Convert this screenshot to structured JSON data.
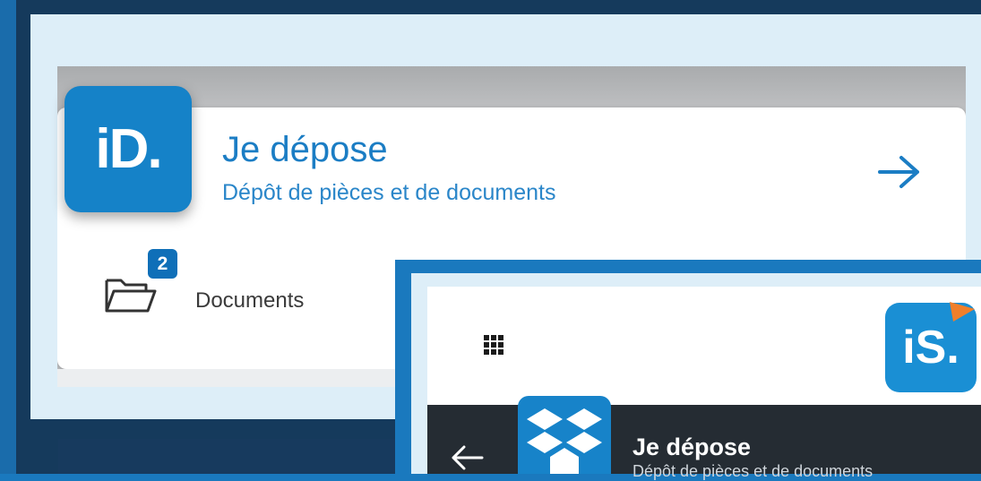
{
  "app_card": {
    "logo_text": "iD.",
    "title": "Je dépose",
    "subtitle": "Dépôt de pièces et de documents",
    "open_icon": "arrow-right-icon",
    "documents": {
      "badge_count": "2",
      "label": "Documents",
      "icon": "folder-icon"
    }
  },
  "app_screen": {
    "menu_icon": "apps-grid-icon",
    "brand_logo_text": "iS.",
    "header": {
      "back_icon": "arrow-left-icon",
      "app_icon": "dropbox-icon",
      "title": "Je dépose",
      "subtitle": "Dépôt de pièces et de documents"
    }
  },
  "colors": {
    "brand_blue": "#1582c8",
    "navy": "#153a5c",
    "dark_bar": "#252c33",
    "accent_orange": "#f07f2a"
  }
}
